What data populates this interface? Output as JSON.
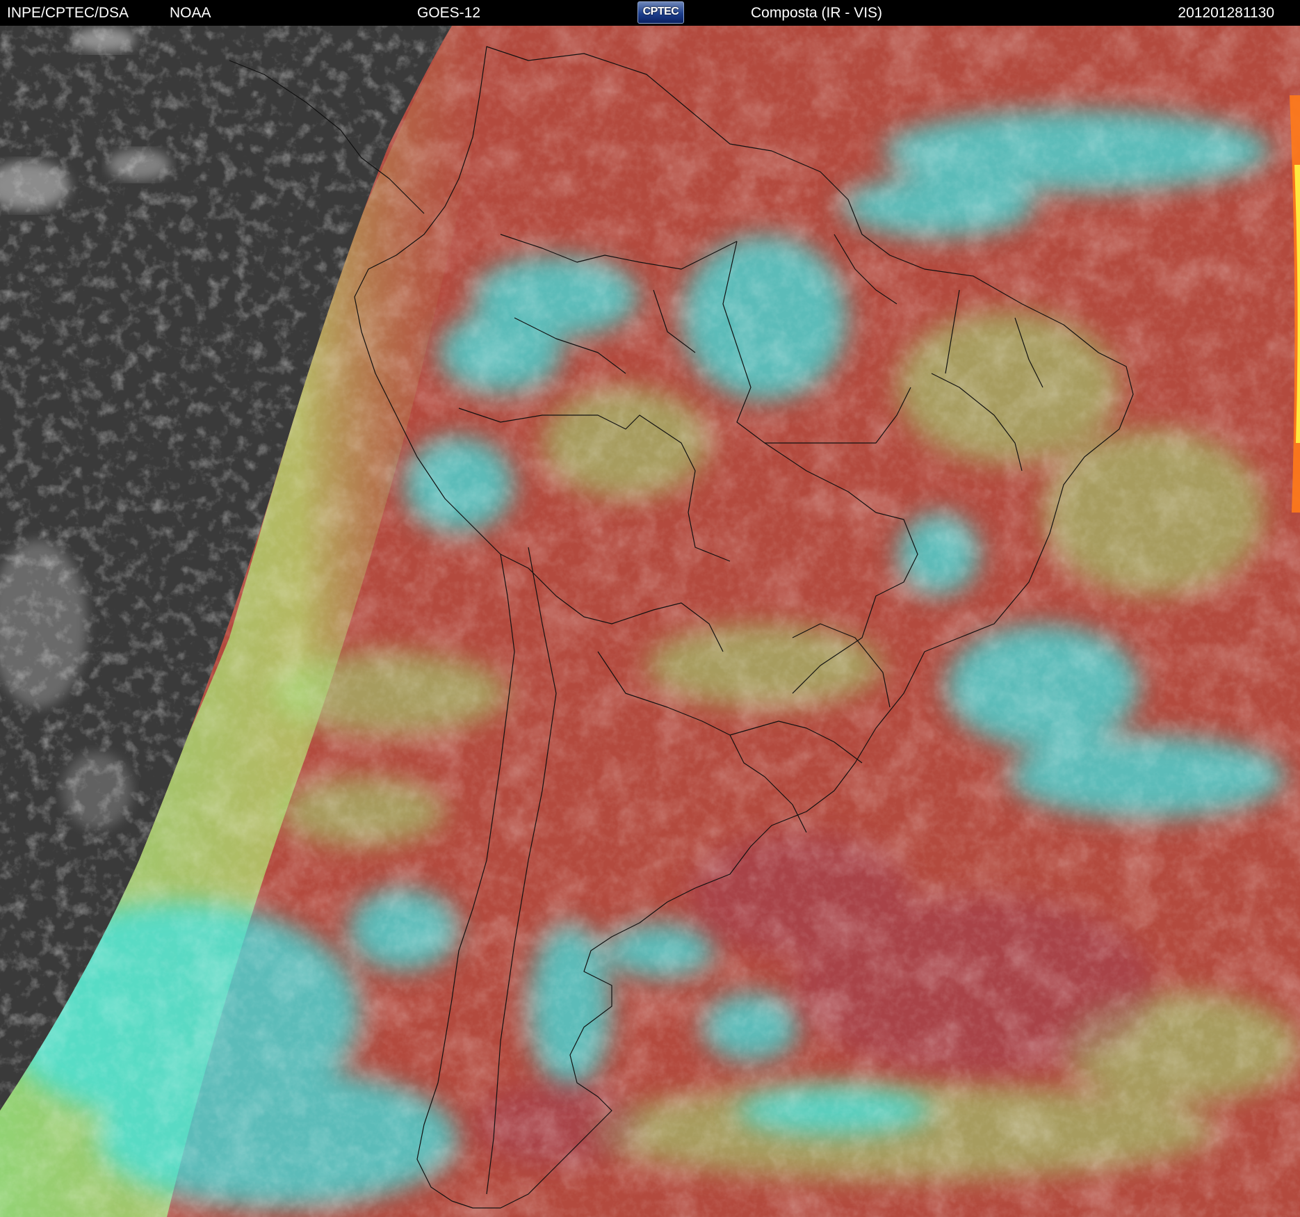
{
  "header": {
    "org": "INPE/CPTEC/DSA",
    "agency": "NOAA",
    "satellite": "GOES-12",
    "logo_text": "CPTEC",
    "product": "Composta (IR - VIS)",
    "timestamp": "201201281130"
  },
  "colors": {
    "night_side": "#3a3a3a",
    "clear_surface": "#b34a3e",
    "low_cloud": "#86e07a",
    "high_cloud": "#3fe2e2",
    "coastline": "#111111"
  }
}
